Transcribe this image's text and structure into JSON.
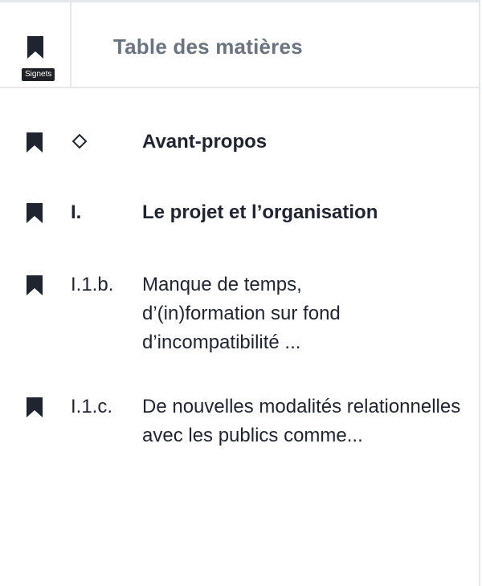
{
  "header": {
    "title": "Table des matières",
    "bookmarks_tooltip": "Signets"
  },
  "toc": {
    "items": [
      {
        "number": "",
        "marker": "diamond-icon",
        "label": "Avant-propos",
        "bold": true
      },
      {
        "number": "I.",
        "label": "Le projet et l’organisation",
        "bold": true
      },
      {
        "number": "I.1.b.",
        "label": "Manque de temps, d’(in)formation sur fond d’incompatibilité ...",
        "bold": false
      },
      {
        "number": "I.1.c.",
        "label": "De nouvelles modalités relationnelles avec les publics comme...",
        "bold": false
      }
    ]
  },
  "colors": {
    "text": "#1f2430",
    "title": "#6b7380",
    "border": "#e6e7ea",
    "tooltip_bg": "#1f2126"
  }
}
